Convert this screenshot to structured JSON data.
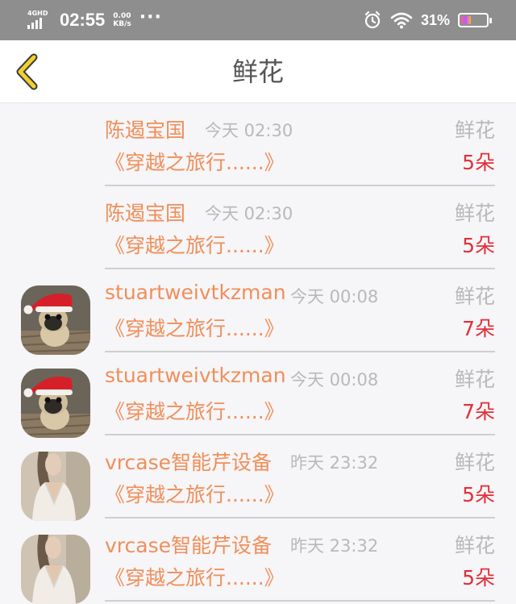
{
  "status_bar": {
    "network": "4GHD",
    "time": "02:55",
    "speed_value": "0.00",
    "speed_unit": "KB/s",
    "more": "···",
    "battery_percent": "31%",
    "icons": [
      "signal-icon",
      "alarm-icon",
      "wifi-icon",
      "battery-icon"
    ]
  },
  "nav": {
    "title": "鲜花",
    "back_icon": "chevron-left-icon",
    "back_color": "#f2cf2f"
  },
  "records": [
    {
      "name": "陈遏宝国",
      "time": "今天 02:30",
      "gift": "鲜花",
      "book": "《穿越之旅行......》",
      "count": "5朵",
      "avatar": "none"
    },
    {
      "name": "陈遏宝国",
      "time": "今天 02:30",
      "gift": "鲜花",
      "book": "《穿越之旅行......》",
      "count": "5朵",
      "avatar": "none"
    },
    {
      "name": "stuartweivtkzman",
      "time": "今天 00:08",
      "gift": "鲜花",
      "book": "《穿越之旅行......》",
      "count": "7朵",
      "avatar": "pug-santa-hat"
    },
    {
      "name": "stuartweivtkzman",
      "time": "今天 00:08",
      "gift": "鲜花",
      "book": "《穿越之旅行......》",
      "count": "7朵",
      "avatar": "pug-santa-hat"
    },
    {
      "name": "vrcase智能芹设备",
      "time": "昨天 23:32",
      "gift": "鲜花",
      "book": "《穿越之旅行......》",
      "count": "5朵",
      "avatar": "woman-photo"
    },
    {
      "name": "vrcase智能芹设备",
      "time": "昨天 23:32",
      "gift": "鲜花",
      "book": "《穿越之旅行......》",
      "count": "5朵",
      "avatar": "woman-photo"
    }
  ],
  "colors": {
    "name": "#ef8f5a",
    "count": "#e0303a",
    "muted": "#b9b9b9",
    "status_bar": "#8e8e8e"
  }
}
